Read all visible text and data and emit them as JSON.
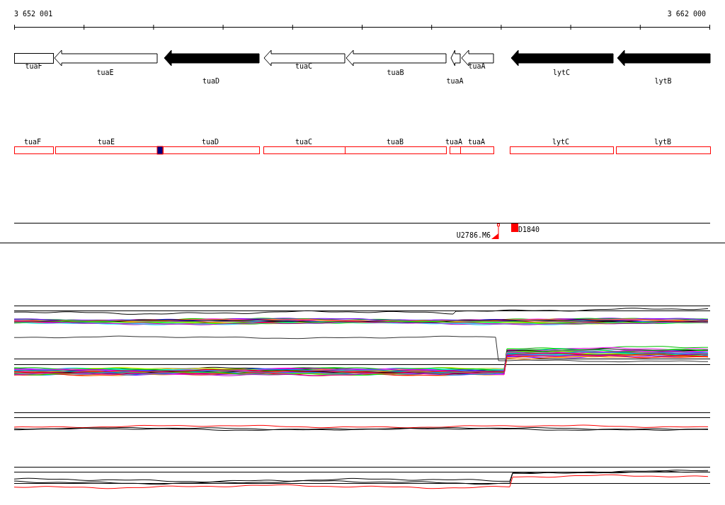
{
  "scale": {
    "start": "3 652 001",
    "end": "3 662 000"
  },
  "genes": [
    {
      "label": "tuaF",
      "kind": "box",
      "filled": false
    },
    {
      "label": "tuaE",
      "kind": "arrow",
      "filled": false
    },
    {
      "label": "tuaD",
      "kind": "arrow",
      "filled": true
    },
    {
      "label": "tuaC",
      "kind": "arrow",
      "filled": false
    },
    {
      "label": "tuaB",
      "kind": "arrow",
      "filled": false
    },
    {
      "label": "tuaA",
      "kind": "arrow",
      "filled": false
    },
    {
      "label": "tuaA",
      "kind": "arrow",
      "filled": false
    },
    {
      "label": "lytC",
      "kind": "arrow",
      "filled": true
    },
    {
      "label": "lytB",
      "kind": "arrow",
      "filled": true
    }
  ],
  "features": [
    {
      "label": "tuaF"
    },
    {
      "label": "tuaE"
    },
    {
      "label": "tuaD"
    },
    {
      "label": "tuaC"
    },
    {
      "label": "tuaB"
    },
    {
      "label": "tuaA"
    },
    {
      "label": "tuaA"
    },
    {
      "label": "lytC"
    },
    {
      "label": "lytB"
    }
  ],
  "markers": [
    {
      "label": "U2786.M6",
      "kind": "triangle"
    },
    {
      "label": "D1840",
      "kind": "square"
    }
  ]
}
